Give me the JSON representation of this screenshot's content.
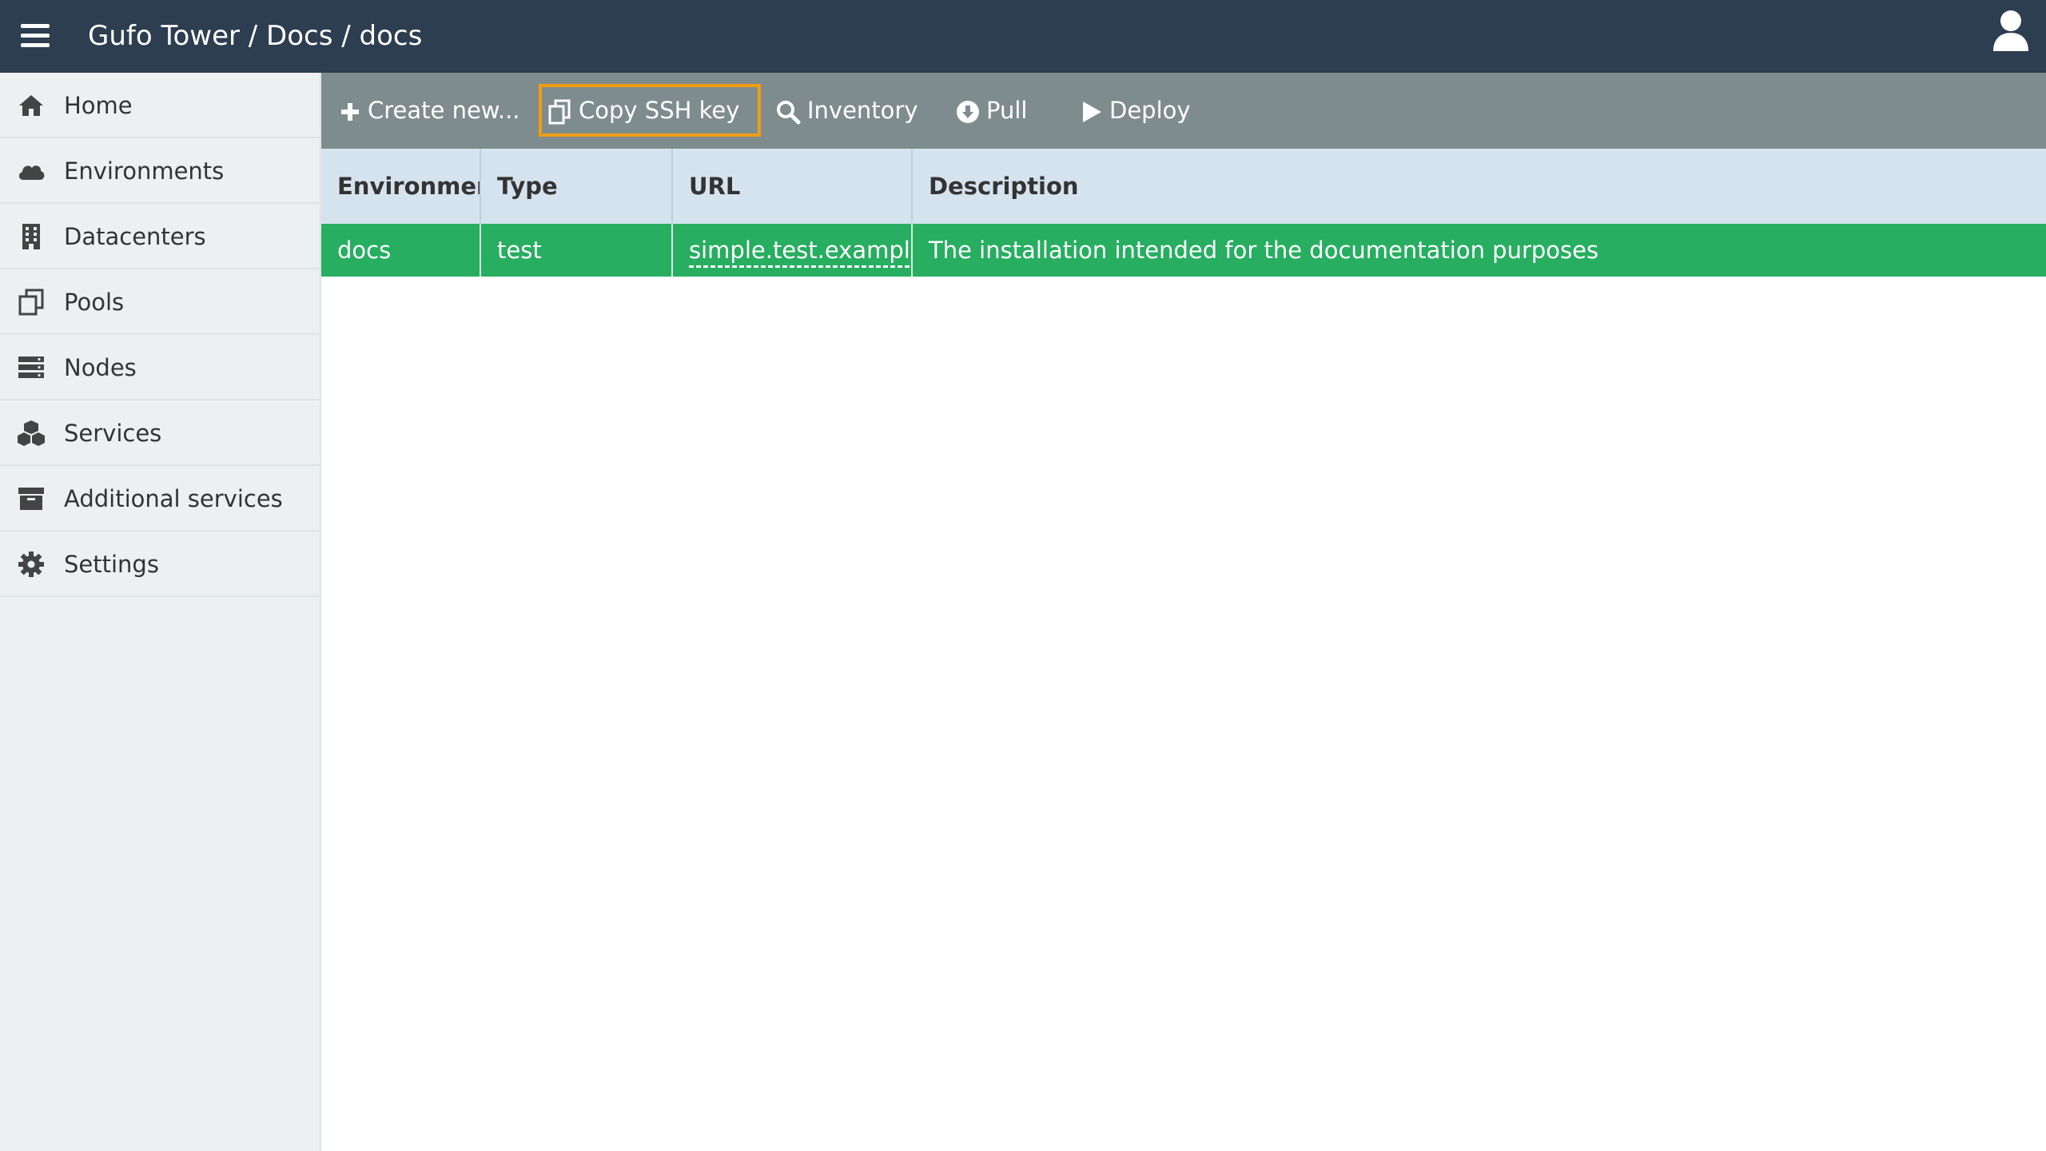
{
  "header": {
    "breadcrumb": "Gufo Tower / Docs / docs"
  },
  "sidebar": {
    "items": [
      {
        "label": "Home",
        "icon": "home-icon"
      },
      {
        "label": "Environments",
        "icon": "cloud-icon"
      },
      {
        "label": "Datacenters",
        "icon": "building-icon"
      },
      {
        "label": "Pools",
        "icon": "clone-icon"
      },
      {
        "label": "Nodes",
        "icon": "server-icon"
      },
      {
        "label": "Services",
        "icon": "cubes-icon"
      },
      {
        "label": "Additional services",
        "icon": "archive-icon"
      },
      {
        "label": "Settings",
        "icon": "gear-icon"
      }
    ]
  },
  "toolbar": {
    "create_label": "Create new...",
    "copy_ssh_label": "Copy SSH key",
    "inventory_label": "Inventory",
    "pull_label": "Pull",
    "deploy_label": "Deploy"
  },
  "table": {
    "columns": [
      "Environment",
      "Type",
      "URL",
      "Description"
    ],
    "rows": [
      {
        "environment": "docs",
        "type": "test",
        "url": "simple.test.example.com",
        "description": "The installation intended for the documentation purposes"
      }
    ]
  },
  "colors": {
    "header_bg": "#2c3e50",
    "toolbar_bg": "#7f8c8d",
    "row_selected": "#27ae60",
    "focus_outline": "#f39c12",
    "table_header_bg": "#d5e3ee",
    "sidebar_bg": "#ecf0f1"
  }
}
